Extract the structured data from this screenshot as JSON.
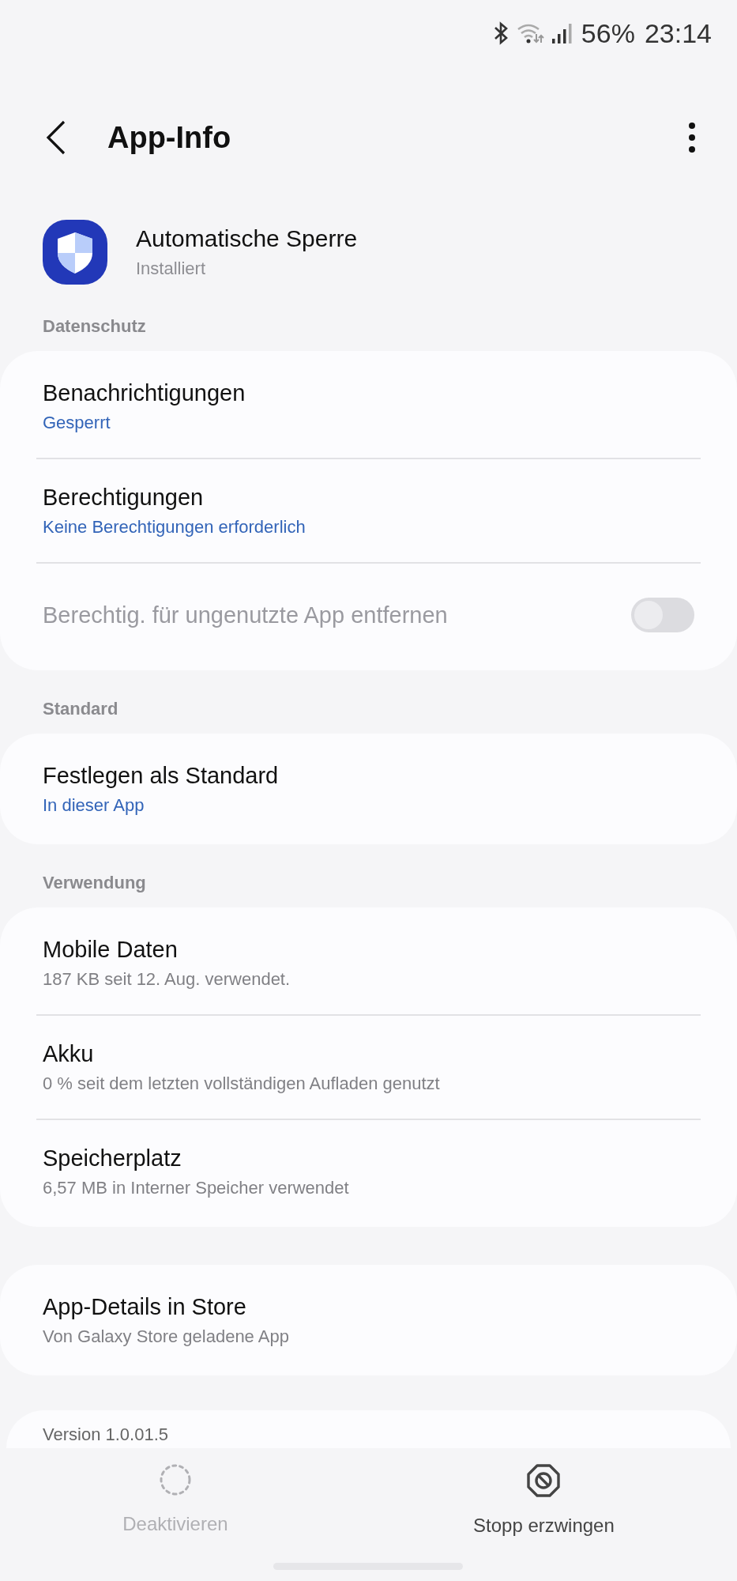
{
  "status_bar": {
    "battery": "56%",
    "time": "23:14"
  },
  "header": {
    "title": "App-Info"
  },
  "app": {
    "name": "Automatische Sperre",
    "status": "Installiert"
  },
  "sections": [
    {
      "heading": "Datenschutz",
      "items": [
        {
          "kind": "link",
          "title": "Benachrichtigungen",
          "subtitle": "Gesperrt"
        },
        {
          "kind": "link",
          "title": "Berechtigungen",
          "subtitle": "Keine Berechtigungen erforderlich"
        },
        {
          "kind": "toggle",
          "title": "Berechtig. für ungenutzte App entfernen",
          "on": false,
          "disabled": true
        }
      ]
    },
    {
      "heading": "Standard",
      "items": [
        {
          "kind": "link",
          "title": "Festlegen als Standard",
          "subtitle": "In dieser App"
        }
      ]
    },
    {
      "heading": "Verwendung",
      "items": [
        {
          "kind": "text",
          "title": "Mobile Daten",
          "subtitle": "187 KB seit 12. Aug. verwendet."
        },
        {
          "kind": "text",
          "title": "Akku",
          "subtitle": "0 % seit dem letzten vollständigen Aufladen genutzt"
        },
        {
          "kind": "text",
          "title": "Speicherplatz",
          "subtitle": "6,57 MB in Interner Speicher verwendet"
        }
      ]
    },
    {
      "items": [
        {
          "kind": "text",
          "title": "App-Details in Store",
          "subtitle": "Von Galaxy Store geladene App"
        }
      ]
    }
  ],
  "version": "Version 1.0.01.5",
  "actions": [
    {
      "kind": "disable",
      "label": "Deaktivieren",
      "disabled": true
    },
    {
      "kind": "stop",
      "label": "Stopp erzwingen",
      "disabled": false
    }
  ]
}
